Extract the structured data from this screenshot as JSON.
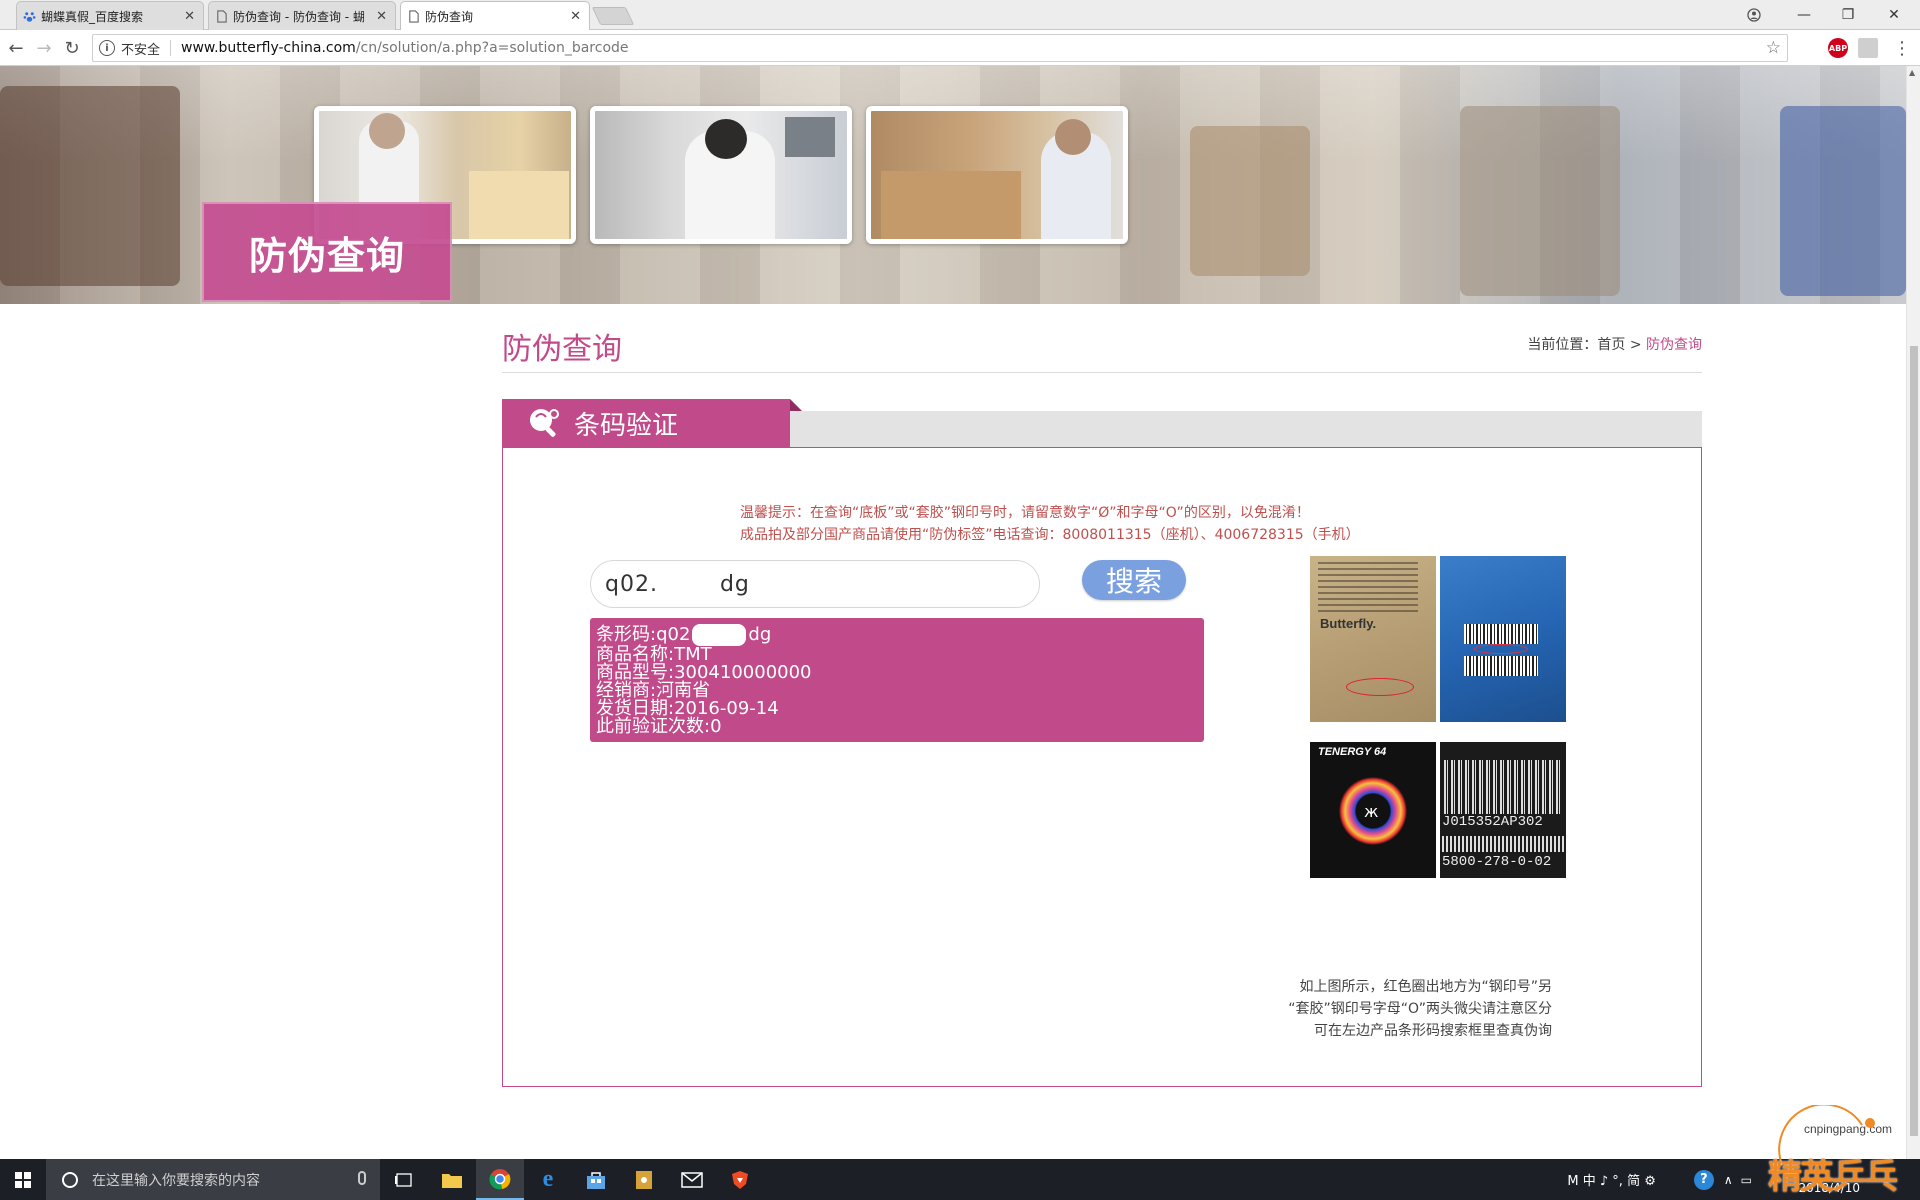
{
  "browser": {
    "tabs": [
      {
        "label": "蝴蝶真假_百度搜索",
        "active": false,
        "icon": "baidu-paw-icon"
      },
      {
        "label": "防伪查询 - 防伪查询 - 蝴",
        "active": false,
        "icon": "document-icon"
      },
      {
        "label": "防伪查询",
        "active": true,
        "icon": "document-icon"
      }
    ],
    "security_label": "不安全",
    "url_host": "www.butterfly-china.com",
    "url_path": "/cn/solution/a.php?a=solution_barcode",
    "ext_abp_label": "ABP"
  },
  "banner": {
    "title": "防伪查询"
  },
  "content": {
    "title": "防伪查询",
    "breadcrumb": {
      "prefix": "当前位置：",
      "home": "首页",
      "separator": ">",
      "current": "防伪查询"
    },
    "tab_title": "条码验证",
    "notice_line1": "温馨提示：在查询“底板”或“套胶”钢印号时，请留意数字“Ø”和字母“O”的区别，以免混淆！",
    "notice_line2": "成品拍及部分国产商品请使用“防伪标签”电话查询：8008011315（座机）、4006728315（手机）"
  },
  "search": {
    "value_start": "q02.",
    "value_end": "dg",
    "button_label": "搜索"
  },
  "result": {
    "lines": [
      {
        "key": "条形码:",
        "val_start": "q02",
        "val_end": "dg",
        "redacted": true
      },
      {
        "key": "商品名称:",
        "val": "TMT"
      },
      {
        "key": "商品型号:",
        "val": "300410000000"
      },
      {
        "key": "经销商:",
        "val": "河南省"
      },
      {
        "key": "发货日期:",
        "val": "2016-09-14"
      },
      {
        "key": "此前验证次数:",
        "val": "0"
      }
    ]
  },
  "reference": {
    "tenergy_label": "TENERGY 64",
    "barcode_text_1": "J015352AP302",
    "barcode_text_2": "5800-278-0-02",
    "caption_line1": "如上图所示，红色圈出地方为“钢印号”另",
    "caption_line2": "“套胶”钢印号字母“O”两头微尖请注意区分",
    "caption_line3": "可在左边产品条形码搜索框里查真伪询"
  },
  "taskbar": {
    "search_placeholder": "在这里输入你要搜索的内容",
    "ime": "M 中 ♪ °, 简 ⚙",
    "date": "2018/4/10",
    "watermark_url": "cnpingpang.com",
    "watermark_text": "精英乒乓网"
  },
  "colors": {
    "brand_pink": "#c14b8a",
    "search_button": "#7aa0e0",
    "notice_red": "#c0504d"
  }
}
